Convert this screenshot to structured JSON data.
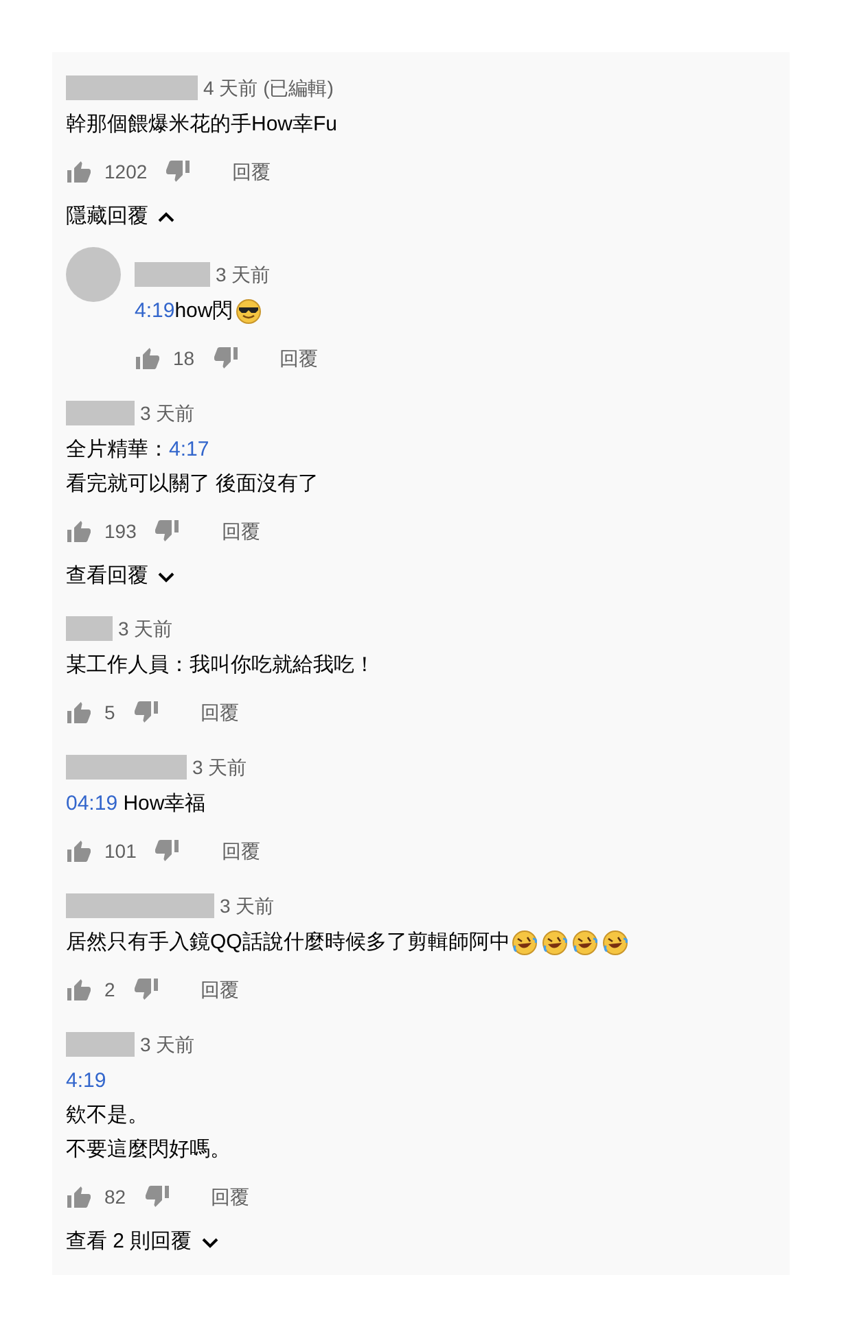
{
  "comments": [
    {
      "kind": "comment",
      "time": "4 天前 (已編輯)",
      "lines": [
        [
          {
            "kind": "text",
            "text": "幹那個餵爆米花的手How幸Fu"
          }
        ]
      ],
      "likes": "1202",
      "reply": "回覆",
      "toggle": {
        "label": "隱藏回覆",
        "expanded": true
      }
    },
    {
      "kind": "reply",
      "time": "3 天前",
      "lines": [
        [
          {
            "kind": "timestamp",
            "text": "4:19"
          },
          {
            "kind": "text",
            "text": "how閃"
          },
          {
            "kind": "sunglasses-emoji"
          }
        ]
      ],
      "likes": "18",
      "reply": "回覆"
    },
    {
      "kind": "comment",
      "time": "3 天前",
      "lines": [
        [
          {
            "kind": "text",
            "text": "全片精華："
          },
          {
            "kind": "timestamp",
            "text": "4:17"
          }
        ],
        [
          {
            "kind": "text",
            "text": "看完就可以關了 後面沒有了"
          }
        ]
      ],
      "likes": "193",
      "reply": "回覆",
      "toggle": {
        "label": "查看回覆",
        "expanded": false
      }
    },
    {
      "kind": "comment",
      "time": "3 天前",
      "lines": [
        [
          {
            "kind": "text",
            "text": "某工作人員：我叫你吃就給我吃！"
          }
        ]
      ],
      "likes": "5",
      "reply": "回覆"
    },
    {
      "kind": "comment",
      "time": "3 天前",
      "lines": [
        [
          {
            "kind": "timestamp",
            "text": "04:19"
          },
          {
            "kind": "text",
            "text": " How幸福"
          }
        ]
      ],
      "likes": "101",
      "reply": "回覆"
    },
    {
      "kind": "comment",
      "time": "3 天前",
      "lines": [
        [
          {
            "kind": "text",
            "text": "居然只有手入鏡QQ話說什麼時候多了剪輯師阿中"
          },
          {
            "kind": "laughing-emoji"
          },
          {
            "kind": "laughing-emoji"
          },
          {
            "kind": "laughing-emoji"
          },
          {
            "kind": "laughing-emoji"
          }
        ]
      ],
      "likes": "2",
      "reply": "回覆"
    },
    {
      "kind": "comment",
      "time": "3 天前",
      "lines": [
        [
          {
            "kind": "timestamp",
            "text": "4:19"
          }
        ],
        [
          {
            "kind": "text",
            "text": "欸不是。"
          }
        ],
        [
          {
            "kind": "text",
            "text": "不要這麼閃好嗎。"
          }
        ]
      ],
      "likes": "82",
      "reply": "回覆",
      "toggle": {
        "label": "查看 2 則回覆",
        "expanded": false
      }
    }
  ]
}
